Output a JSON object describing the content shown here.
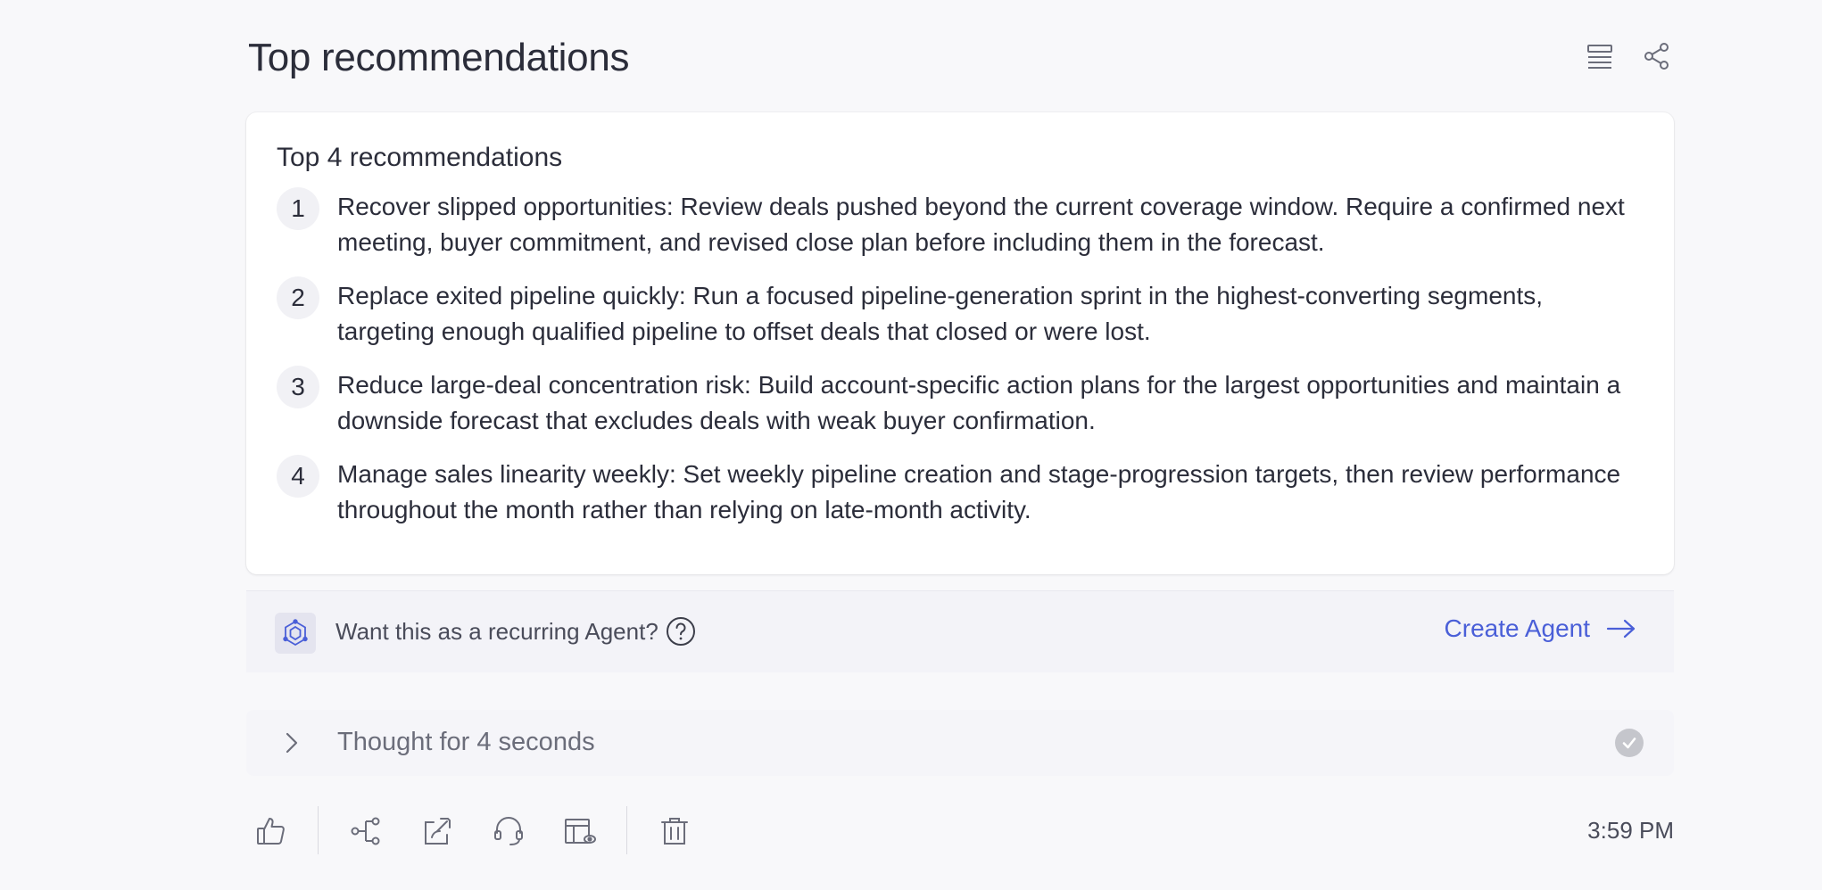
{
  "header": {
    "title": "Top recommendations",
    "actions": [
      {
        "icon": "list-view-icon"
      },
      {
        "icon": "share-icon"
      }
    ]
  },
  "card": {
    "title": "Top 4 recommendations",
    "items": [
      {
        "number": "1",
        "text": "Recover slipped opportunities: Review deals pushed beyond the current coverage window. Require a confirmed next meeting, buyer commitment, and revised close plan before including them in the forecast."
      },
      {
        "number": "2",
        "text": "Replace exited pipeline quickly: Run a focused pipeline-generation sprint in the highest-converting segments, targeting enough qualified pipeline to offset deals that closed or were lost."
      },
      {
        "number": "3",
        "text": "Reduce large-deal concentration risk: Build account-specific action plans for the largest opportunities and maintain a downside forecast that excludes deals with weak buyer confirmation."
      },
      {
        "number": "4",
        "text": "Manage sales linearity weekly: Set weekly pipeline creation and stage-progression targets, then review performance throughout the month rather than relying on late-month activity."
      }
    ]
  },
  "agent_bar": {
    "prompt": "Want this as a recurring Agent?",
    "cta_label": "Create Agent",
    "accent_color": "#4a5fd8"
  },
  "thought": {
    "label": "Thought for 4 seconds"
  },
  "toolbar": {
    "buttons": [
      "thumbs-up-icon",
      "flow-icon",
      "share-link-icon",
      "support-headset-icon",
      "table-view-icon",
      "delete-icon"
    ],
    "timestamp": "3:59 PM"
  }
}
